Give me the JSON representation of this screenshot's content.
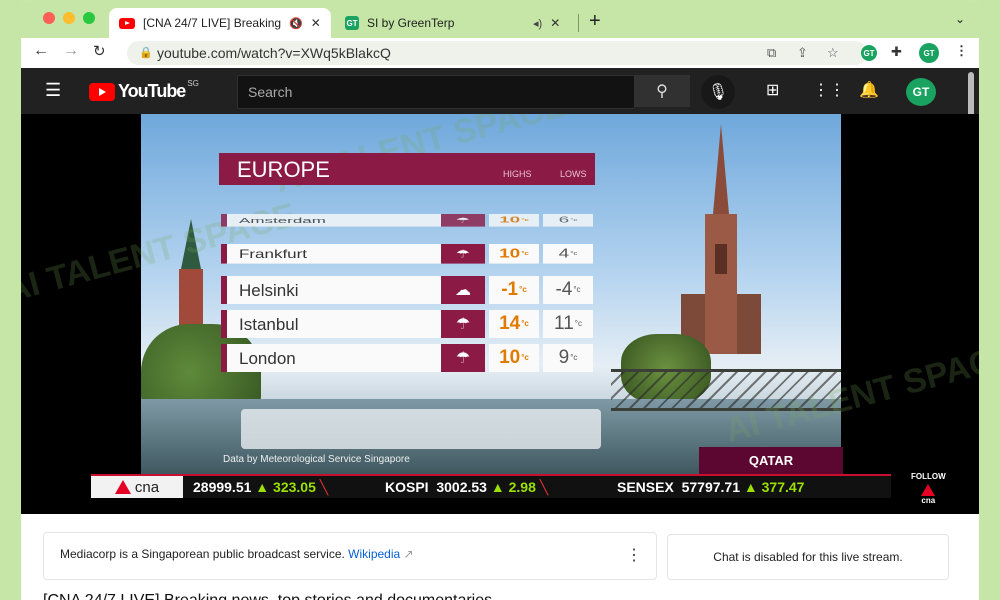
{
  "browser": {
    "tabs": [
      {
        "title": "[CNA 24/7 LIVE] Breaking",
        "active": true
      },
      {
        "title": "SI by GreenTerp",
        "active": false
      }
    ],
    "url": "youtube.com/watch?v=XWq5kBlakcQ",
    "colors": {
      "frame": "#c5e6a6"
    }
  },
  "youtube": {
    "logo_text": "YouTube",
    "region": "SG",
    "search_placeholder": "Search",
    "avatar_initials": "GT"
  },
  "video": {
    "panel_title": "EUROPE",
    "col_highs": "HIGHS",
    "col_lows": "LOWS",
    "rows": [
      {
        "city": "Amsterdam",
        "icon": "rain-icon",
        "high": "10",
        "low": "6"
      },
      {
        "city": "Frankfurt",
        "icon": "rain-icon",
        "high": "10",
        "low": "4"
      },
      {
        "city": "Helsinki",
        "icon": "cloud-icon",
        "high": "-1",
        "low": "-4"
      },
      {
        "city": "Istanbul",
        "icon": "rain-icon",
        "high": "14",
        "low": "11"
      },
      {
        "city": "London",
        "icon": "rain-icon",
        "high": "10",
        "low": "9"
      }
    ],
    "deg_unit": "°c",
    "credit": "Data by Meteorological Service Singapore",
    "sponsor": "QATAR",
    "ticker": {
      "brand": "cna",
      "items": [
        {
          "value": "28999.51",
          "change": "323.05",
          "dir": "up"
        },
        {
          "name": "KOSPI",
          "value": "3002.53",
          "change": "2.98",
          "dir": "up"
        },
        {
          "name": "SENSEX",
          "value": "57797.71",
          "change": "377.47",
          "dir": "up"
        }
      ]
    },
    "follow_label": "FOLLOW",
    "follow_brand": "cna",
    "watermark": "AI TALENT SPACE"
  },
  "below": {
    "info_text": "Mediacorp is a Singaporean public broadcast service.",
    "info_link": "Wikipedia",
    "chat_disabled": "Chat is disabled for this live stream.",
    "video_title": "[CNA 24/7 LIVE] Breaking news, top stories and documentaries"
  }
}
